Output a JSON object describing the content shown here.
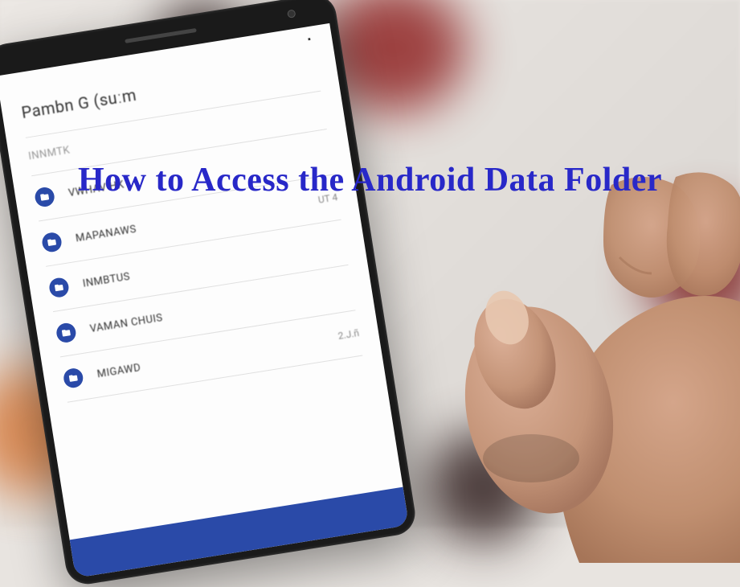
{
  "overlay": {
    "title": "How to Access the Android Data Folder"
  },
  "phone": {
    "header": {
      "title": "Pambn G (suːm"
    },
    "items": [
      {
        "label": "INNMTK",
        "meta": ""
      },
      {
        "label": "VWHAV HK",
        "meta": ""
      },
      {
        "label": "MAPANAWS",
        "meta": "UT 4"
      },
      {
        "label": "INMBTUS",
        "meta": ""
      },
      {
        "label": "VAMAN CHUIS",
        "meta": ""
      },
      {
        "label": "MIGAWD",
        "meta": "2.J.ñ"
      }
    ]
  }
}
